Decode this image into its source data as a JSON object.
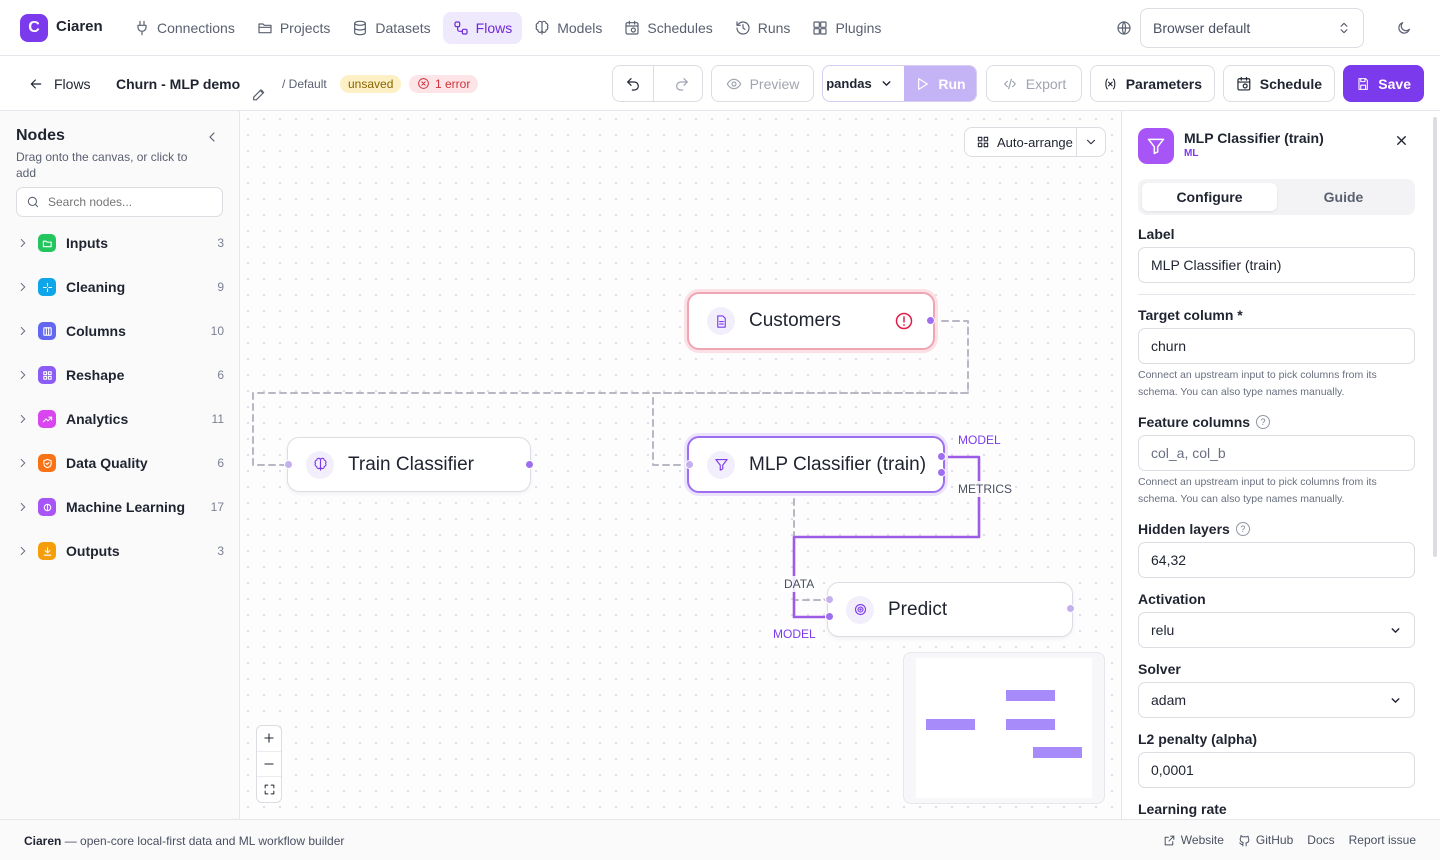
{
  "brand": {
    "logo_letter": "C",
    "name": "Ciaren",
    "accent": "#7c3aed"
  },
  "nav": {
    "items": [
      {
        "label": "Connections",
        "icon": "plug-icon"
      },
      {
        "label": "Projects",
        "icon": "folder-icon"
      },
      {
        "label": "Datasets",
        "icon": "database-icon"
      },
      {
        "label": "Flows",
        "icon": "workflow-icon",
        "active": true
      },
      {
        "label": "Models",
        "icon": "brain-icon"
      },
      {
        "label": "Schedules",
        "icon": "calendar-clock-icon"
      },
      {
        "label": "Runs",
        "icon": "history-icon"
      },
      {
        "label": "Plugins",
        "icon": "puzzle-icon"
      }
    ],
    "language": "Browser default"
  },
  "toolbar": {
    "back_label": "Flows",
    "flow_name": "Churn - MLP demo",
    "project": "/ Default",
    "unsaved_badge": "unsaved",
    "error_badge": "1 error",
    "preview_label": "Preview",
    "engine": "pandas",
    "run_label": "Run",
    "export_label": "Export",
    "parameters_label": "Parameters",
    "schedule_label": "Schedule",
    "save_label": "Save"
  },
  "sidebar": {
    "title": "Nodes",
    "subtitle": "Drag onto the canvas, or click to add",
    "search_placeholder": "Search nodes...",
    "categories": [
      {
        "label": "Inputs",
        "count": "3",
        "color": "#22c55e",
        "icon": "folder-open-icon"
      },
      {
        "label": "Cleaning",
        "count": "9",
        "color": "#0ea5e9",
        "icon": "sparkles-icon"
      },
      {
        "label": "Columns",
        "count": "10",
        "color": "#6366f1",
        "icon": "columns-icon"
      },
      {
        "label": "Reshape",
        "count": "6",
        "color": "#8b5cf6",
        "icon": "grid-icon"
      },
      {
        "label": "Analytics",
        "count": "11",
        "color": "#d946ef",
        "icon": "trending-up-icon"
      },
      {
        "label": "Data Quality",
        "count": "6",
        "color": "#f97316",
        "icon": "shield-check-icon"
      },
      {
        "label": "Machine Learning",
        "count": "17",
        "color": "#a855f7",
        "icon": "brain-icon"
      },
      {
        "label": "Outputs",
        "count": "3",
        "color": "#f59e0b",
        "icon": "download-icon"
      }
    ]
  },
  "canvas": {
    "auto_arrange_label": "Auto-arrange",
    "nodes": {
      "customers": "Customers",
      "train_classifier": "Train Classifier",
      "mlp_classifier": "MLP Classifier (train)",
      "predict": "Predict"
    },
    "edge_labels": {
      "model_out": "MODEL",
      "metrics_out": "METRICS",
      "data_in": "DATA",
      "model_in": "MODEL"
    }
  },
  "panel": {
    "title": "MLP Classifier (train)",
    "subtitle": "ML",
    "tabs": [
      "Configure",
      "Guide"
    ],
    "label_field": {
      "label": "Label",
      "value": "MLP Classifier (train)"
    },
    "target_column": {
      "label": "Target column *",
      "value": "churn",
      "hint": "Connect an upstream input to pick columns from its schema. You can also type names manually."
    },
    "feature_columns": {
      "label": "Feature columns",
      "placeholder": "col_a, col_b",
      "hint": "Connect an upstream input to pick columns from its schema. You can also type names manually."
    },
    "hidden_layers": {
      "label": "Hidden layers",
      "value": "64,32"
    },
    "activation": {
      "label": "Activation",
      "value": "relu"
    },
    "solver": {
      "label": "Solver",
      "value": "adam"
    },
    "alpha": {
      "label": "L2 penalty (alpha)",
      "value": "0,0001"
    },
    "learning_rate": {
      "label": "Learning rate"
    }
  },
  "footer": {
    "brand": "Ciaren",
    "tagline": "— open-core local-first data and ML workflow builder",
    "links": [
      "Website",
      "GitHub",
      "Docs",
      "Report issue"
    ]
  }
}
